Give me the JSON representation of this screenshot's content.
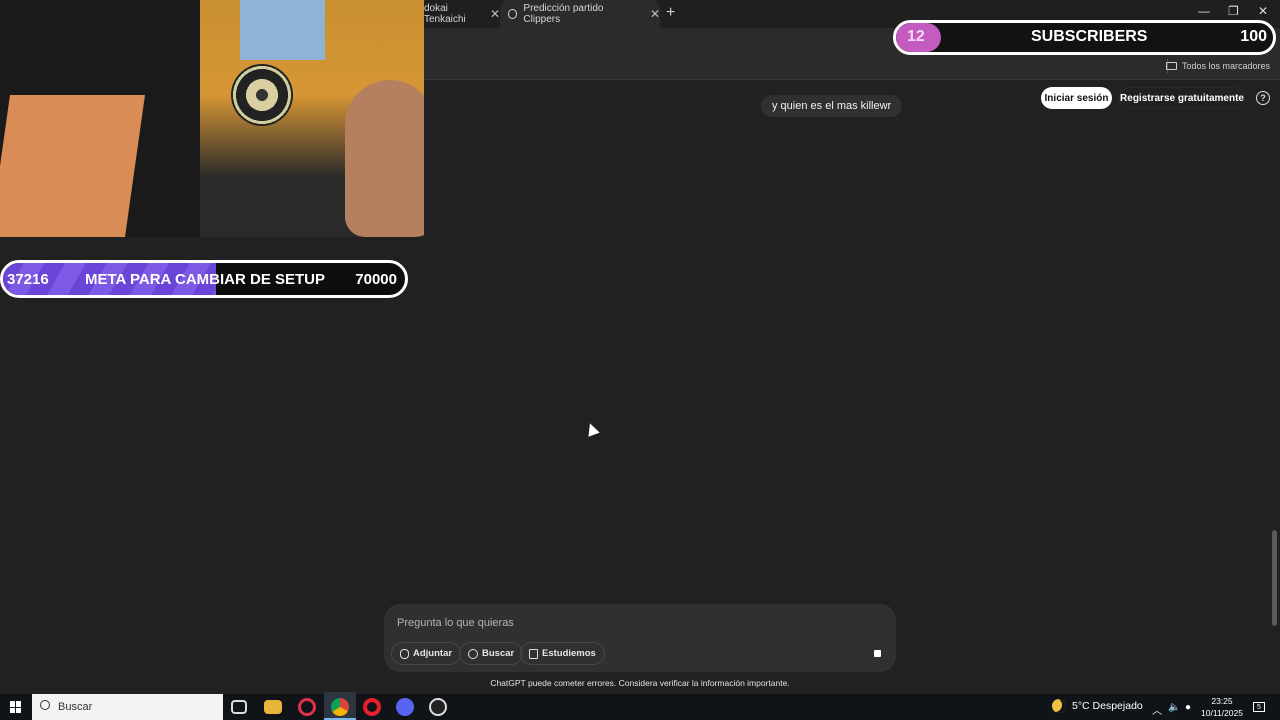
{
  "browser": {
    "tabs": [
      {
        "label": "dokai Tenkaichi"
      },
      {
        "label": "Predicción partido Clippers"
      }
    ],
    "new_tab_symbol": "+",
    "close_symbol": "✕",
    "window_controls": {
      "minimize": "—",
      "restore": "❐",
      "close": "✕"
    },
    "bookmarks_folder": "Todos los marcadores"
  },
  "chat": {
    "login_label": "Iniciar sesión",
    "signup_label": "Registrarse gratuitamente",
    "help_symbol": "?",
    "user_message": "y quien es el mas killewr",
    "composer": {
      "placeholder": "Pregunta lo que quieras",
      "attach_label": "Adjuntar",
      "search_label": "Buscar",
      "study_label": "Estudiemos"
    },
    "disclaimer": "ChatGPT puede cometer errores. Considera verificar la información importante."
  },
  "overlay": {
    "goal": {
      "current": "37216",
      "title": "META PARA CAMBIAR DE SETUP",
      "target": "70000",
      "progress": 0.53
    },
    "subs": {
      "current": "12",
      "title": "SUBSCRIBERS",
      "target": "100",
      "progress": 0.12
    }
  },
  "taskbar": {
    "search_placeholder": "Buscar",
    "apps": [
      "task-view-icon",
      "file-explorer-icon",
      "opera-gx-icon",
      "chrome-icon",
      "opera-icon",
      "discord-icon",
      "obs-icon"
    ],
    "weather": "5°C  Despejado",
    "time": "23:25",
    "date": "10/11/2025",
    "notifications": "5"
  },
  "colors": {
    "page_bg": "#212121",
    "goal_fill": "#6a45d8",
    "subs_fill": "#c45cc0",
    "taskbar_bg": "#101418"
  }
}
